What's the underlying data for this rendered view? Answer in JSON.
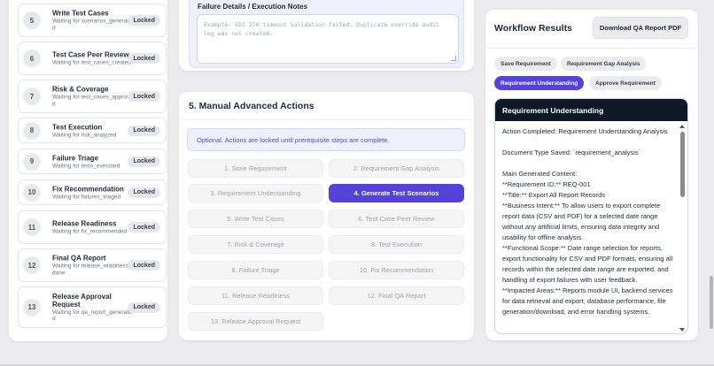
{
  "steps": [
    {
      "num": "5",
      "title": "Write Test Cases",
      "sub": "Waiting for scenarios_generated",
      "status": "Locked"
    },
    {
      "num": "6",
      "title": "Test Case Peer Review",
      "sub": "Waiting for test_cases_created",
      "status": "Locked"
    },
    {
      "num": "7",
      "title": "Risk & Coverage",
      "sub": "Waiting for test_cases_approved",
      "status": "Locked"
    },
    {
      "num": "8",
      "title": "Test Execution",
      "sub": "Waiting for risk_analyzed",
      "status": "Locked"
    },
    {
      "num": "9",
      "title": "Failure Triage",
      "sub": "Waiting for tests_executed",
      "status": "Locked"
    },
    {
      "num": "10",
      "title": "Fix Recommendation",
      "sub": "Waiting for failures_triaged",
      "status": "Locked"
    },
    {
      "num": "11",
      "title": "Release Readiness",
      "sub": "Waiting for fix_recommended",
      "status": "Locked"
    },
    {
      "num": "12",
      "title": "Final QA Report",
      "sub": "Waiting for release_readiness_done",
      "status": "Locked"
    },
    {
      "num": "13",
      "title": "Release Approval Request",
      "sub": "Waiting for qa_report_generated",
      "status": "Locked"
    }
  ],
  "notes": {
    "label": "Failure Details / Execution Notes",
    "placeholder": "Example: EDI 270 timeout validation failed. Duplicate override audit log was not created."
  },
  "actions": {
    "title": "5. Manual Advanced Actions",
    "notice": "Optional. Actions are locked until prerequisite steps are complete.",
    "buttons": [
      "1. Save Requirement",
      "2. Requirement Gap Analysis",
      "3. Requirement Understanding",
      "4. Generate Test Scenarios",
      "5. Write Test Cases",
      "6. Test Case Peer Review",
      "7. Risk & Coverage",
      "8. Test Execution",
      "9. Failure Triage",
      "10. Fix Recommendation",
      "11. Release Readiness",
      "12. Final QA Report",
      "13. Release Approval Request"
    ],
    "active_button": "4. Generate Test Scenarios"
  },
  "results": {
    "title": "Workflow Results",
    "download_label": "Download QA Report PDF",
    "tabs": [
      "Save Requirement",
      "Requirement Gap Analysis",
      "Requirement Understanding",
      "Approve Requirement"
    ],
    "active_tab": "Requirement Understanding",
    "output_title": "Requirement Understanding",
    "output_lines": [
      "Action Completed: Requirement Understanding Analysis",
      "",
      "Document Type Saved: `requirement_analysis`",
      "",
      "Main Generated Content:",
      "**Requirement ID:** REQ-001",
      "**Title:** Export All Report Records",
      "**Business Intent:** To allow users to export complete report data (CSV and PDF) for a selected date range without any artificial limits, ensuring data integrity and usability for offline analysis.",
      "**Functional Scope:** Date range selection for reports, export functionality for CSV and PDF formats, ensuring all records within the selected date range are exported, and handling of export failures with user feedback.",
      "**Impacted Areas:** Reports module UI, backend services for data retrieval and export, database performance, file generation/download, and error handling systems."
    ]
  },
  "colors": {
    "accent": "#5443d6",
    "output_header": "#0f1729",
    "notice_bg": "#eef0fc"
  }
}
